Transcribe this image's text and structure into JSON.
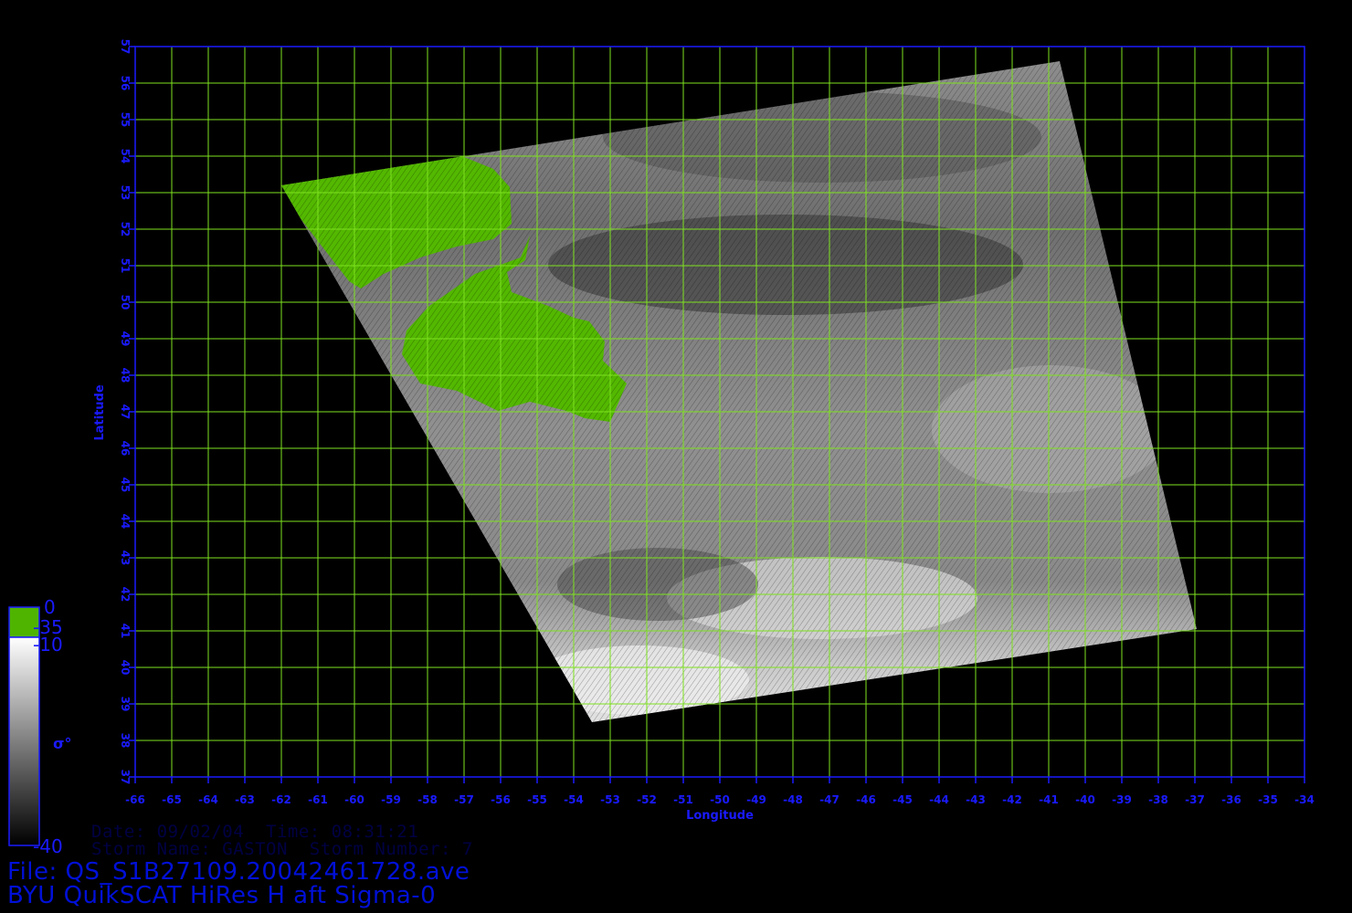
{
  "colors": {
    "frame": "#1a1aff",
    "grid": "#7ee21f",
    "land": "#53b800",
    "text_blue": "#1a1aff",
    "info_text": "#000044"
  },
  "axes": {
    "xlabel": "Longitude",
    "ylabel": "Latitude",
    "lon_range": [
      -66,
      -34
    ],
    "lat_range": [
      37,
      57
    ],
    "lon_ticks": [
      -66,
      -65,
      -64,
      -63,
      -62,
      -61,
      -60,
      -59,
      -58,
      -57,
      -56,
      -55,
      -54,
      -53,
      -52,
      -51,
      -50,
      -49,
      -48,
      -47,
      -46,
      -45,
      -44,
      -43,
      -42,
      -41,
      -40,
      -39,
      -38,
      -37,
      -36,
      -35,
      -34
    ],
    "lat_ticks": [
      37,
      38,
      39,
      40,
      41,
      42,
      43,
      44,
      45,
      46,
      47,
      48,
      49,
      50,
      51,
      52,
      53,
      54,
      55,
      56,
      57
    ]
  },
  "swath_corners": [
    {
      "lon": -62.0,
      "lat": 53.2
    },
    {
      "lon": -40.7,
      "lat": 56.6
    },
    {
      "lon": -36.95,
      "lat": 41.05
    },
    {
      "lon": -53.5,
      "lat": 38.5
    }
  ],
  "colorbar": {
    "labels": {
      "top": "0",
      "land_bottom": "-35",
      "sea_top": "-10",
      "bottom": "-40"
    },
    "symbol": "σ°",
    "land_color": "#4fb400",
    "sea_top_color": "#ffffff",
    "sea_bottom_color": "#000000"
  },
  "info": {
    "line1": "Date: 09/02/04  Time: 08:31:21",
    "line2": "Storm Name: GASTON  Storm Number: 7",
    "file": "File: QS_S1B27109.20042461728.ave",
    "title": "BYU QuikSCAT HiRes H aft Sigma-0"
  }
}
